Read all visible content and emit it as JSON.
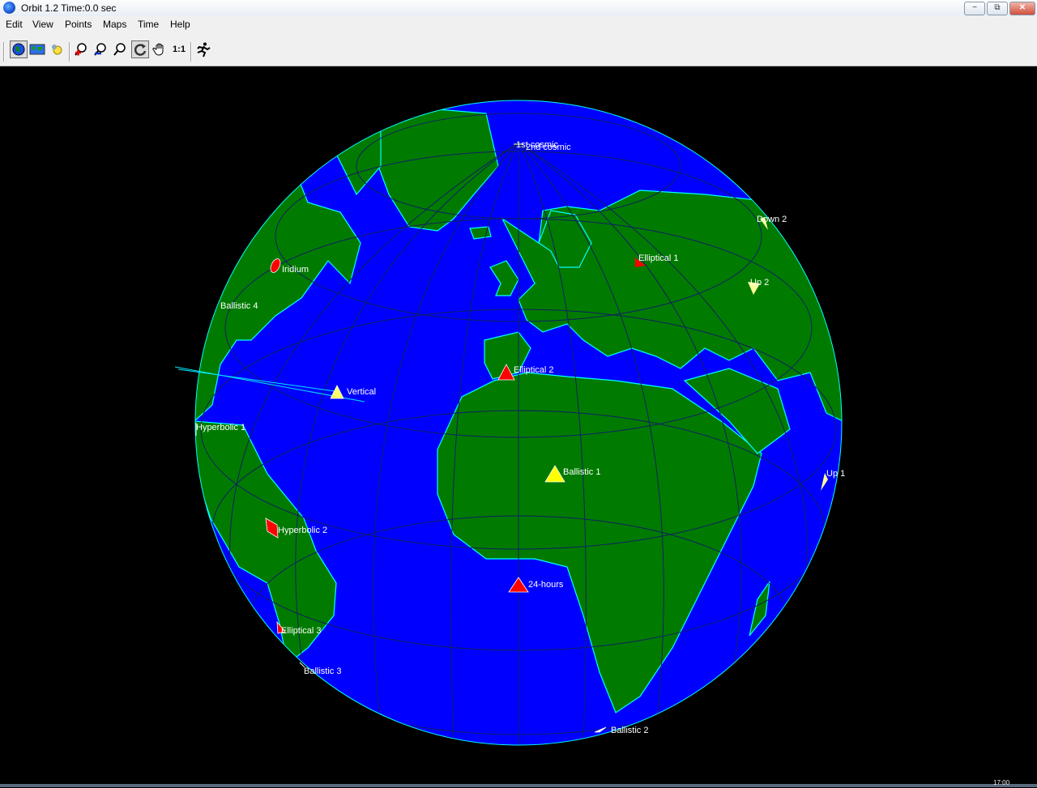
{
  "window": {
    "title": "Orbit 1.2  Time:0.0 sec",
    "minimize": "−",
    "maximize": "⧉",
    "close": "✕"
  },
  "menu": [
    "Edit",
    "View",
    "Points",
    "Maps",
    "Time",
    "Help"
  ],
  "toolbar": {
    "tools": [
      "globe-view",
      "flat-map",
      "orbit-view",
      "zoom-in",
      "zoom-out",
      "zoom-fit",
      "rotate",
      "pan",
      "one-to-one",
      "run"
    ],
    "one_to_one_label": "1:1"
  },
  "globe": {
    "ocean_color": "#0000ff",
    "land_color": "#007b00",
    "grid_color": "#102060",
    "coast_color": "#00ffff"
  },
  "satellites": [
    {
      "name": "1st cosmic",
      "color": "#ffffff"
    },
    {
      "name": "2nd cosmic",
      "color": "#ffffff"
    },
    {
      "name": "Down 2",
      "color": "#ffff99"
    },
    {
      "name": "Elliptical 1",
      "color": "#ff0000"
    },
    {
      "name": "Iridium",
      "color": "#ff0000"
    },
    {
      "name": "Up 2",
      "color": "#ffff99"
    },
    {
      "name": "Ballistic 4",
      "color": "#ffffff"
    },
    {
      "name": "Elliptical 2",
      "color": "#ff0000"
    },
    {
      "name": "Vertical",
      "color": "#ffff66"
    },
    {
      "name": "Hyperbolic 1",
      "color": "#ffffff"
    },
    {
      "name": "Ballistic 1",
      "color": "#ffff00"
    },
    {
      "name": "Up 1",
      "color": "#ffff99"
    },
    {
      "name": "Hyperbolic 2",
      "color": "#ff0000"
    },
    {
      "name": "24-hours",
      "color": "#ff0000"
    },
    {
      "name": "Elliptical  3",
      "color": "#ff0000"
    },
    {
      "name": "Ballistic 3",
      "color": "#ffffff"
    },
    {
      "name": "Ballistic 2",
      "color": "#ffffff"
    }
  ],
  "clock": "17:00"
}
